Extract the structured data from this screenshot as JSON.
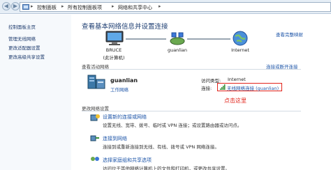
{
  "breadcrumb": {
    "items": [
      "控制面板",
      "所有控制面板项",
      "网络和共享中心"
    ]
  },
  "sidebar": {
    "items": [
      {
        "label": "控制面板主页"
      },
      {
        "label": "管理无线网络"
      },
      {
        "label": "更改适配器设置"
      },
      {
        "label": "更改高级共享设置"
      }
    ]
  },
  "main": {
    "heading": "查看基本网络信息并设置连接",
    "full_map_link": "查看完整映射",
    "map": {
      "computer": "BRUCE",
      "computer_sub": "(此计算机)",
      "network": "guanlian",
      "internet": "Internet"
    },
    "active_networks": {
      "title": "查看活动网络",
      "connect_link": "连接或断开连接",
      "network_name": "guanlian",
      "network_type": "工作网络",
      "access_type_label": "访问类型:",
      "access_type_value": "Internet",
      "connections_label": "连接:",
      "connection_value": "无线网络连接 (guanlian)"
    },
    "annotation": "点击这里",
    "change_settings": {
      "title": "更改网络设置",
      "tasks": [
        {
          "title": "设置新的连接或网络",
          "desc": "设置无线、宽带、拨号、临时或 VPN 连接；或设置路由器或访问点。"
        },
        {
          "title": "连接到网络",
          "desc": "连接到或重新连接到无线、有线、拨号或 VPN 网络连接。"
        },
        {
          "title": "选择家庭组和共享选项",
          "desc": "访问位于其他网络计算机上的文件和打印机，或更改共享设置。"
        }
      ]
    }
  },
  "colors": {
    "accent": "#1d55a8",
    "annotation": "#e2231a",
    "heading": "#1f3f73"
  }
}
